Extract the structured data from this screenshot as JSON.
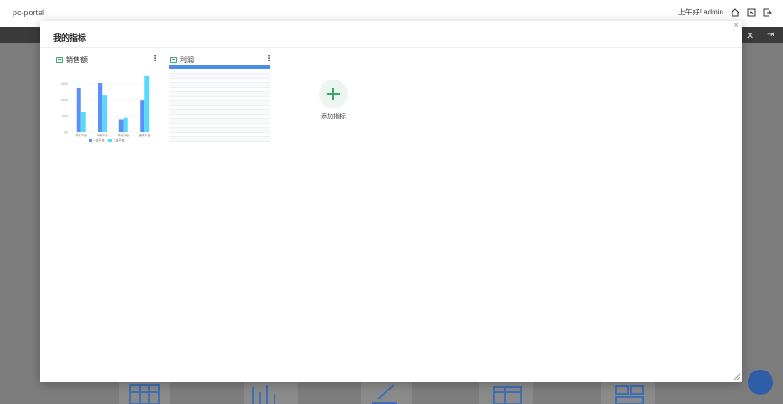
{
  "app": {
    "title": "pc-portal",
    "greeting": "上午好!",
    "user": "admin"
  },
  "modal": {
    "title": "我的指标",
    "close_label": "×",
    "add_label": "添加指标"
  },
  "cards": [
    {
      "name": "销售额"
    },
    {
      "name": "利润"
    }
  ],
  "table_rows": [
    "",
    "",
    "",
    "",
    "",
    "",
    "",
    "",
    "",
    "",
    "",
    "",
    "",
    "",
    "",
    ""
  ],
  "colors": {
    "series1": "#5b8ff9",
    "series2": "#5ad8fa",
    "accent": "#3aa86b"
  },
  "chart_data": {
    "type": "bar",
    "categories": [
      "华东平台",
      "华南平台",
      "华北平台",
      "西南平台"
    ],
    "series": [
      {
        "name": "一级平台",
        "values": [
          1380,
          1520,
          380,
          980
        ]
      },
      {
        "name": "二级平台",
        "values": [
          620,
          1150,
          430,
          1750
        ]
      }
    ],
    "y_ticks": [
      "1500",
      "1000",
      "500",
      "0k"
    ],
    "ylim": [
      0,
      1800
    ],
    "legend": "bottom"
  }
}
